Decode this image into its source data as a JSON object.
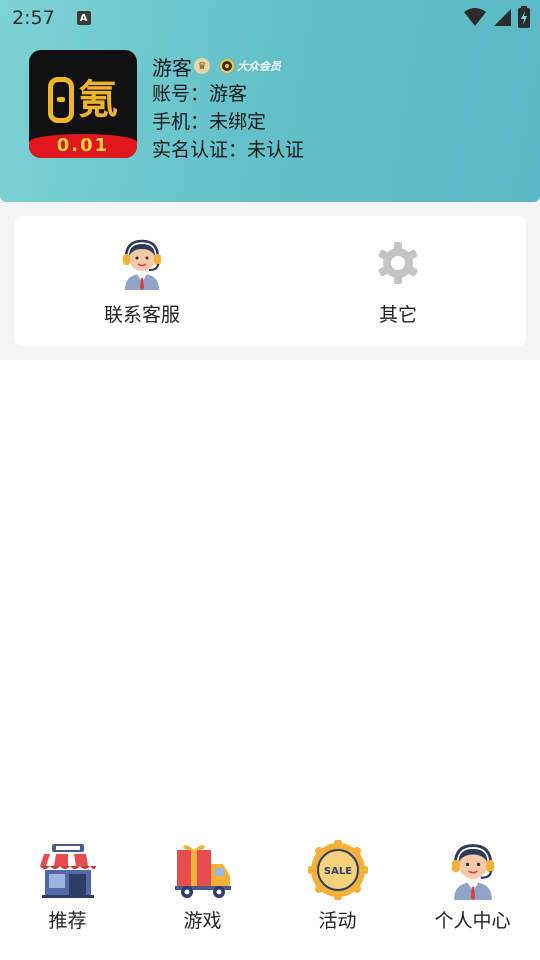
{
  "status_bar": {
    "time": "2:57",
    "notification_letter": "A"
  },
  "profile": {
    "logo_price": "0.01",
    "logo_char": "氪",
    "name": "游客",
    "member_label": "大众会员",
    "account_line": "账号：游客",
    "phone_line": "手机：未绑定",
    "verify_line": "实名认证：未认证"
  },
  "card": {
    "items": [
      {
        "label": "联系客服",
        "icon": "customer-service-icon"
      },
      {
        "label": "其它",
        "icon": "gear-icon"
      }
    ]
  },
  "tabbar": {
    "tabs": [
      {
        "label": "推荐",
        "icon": "store-icon"
      },
      {
        "label": "游戏",
        "icon": "gift-truck-icon"
      },
      {
        "label": "活动",
        "icon": "sale-badge-icon"
      },
      {
        "label": "个人中心",
        "icon": "customer-service-icon"
      }
    ]
  },
  "colors": {
    "header_gradient_start": "#7dd3d6",
    "header_gradient_end": "#5ab9c4",
    "logo_gold": "#f0b429",
    "logo_red": "#e0171c"
  }
}
